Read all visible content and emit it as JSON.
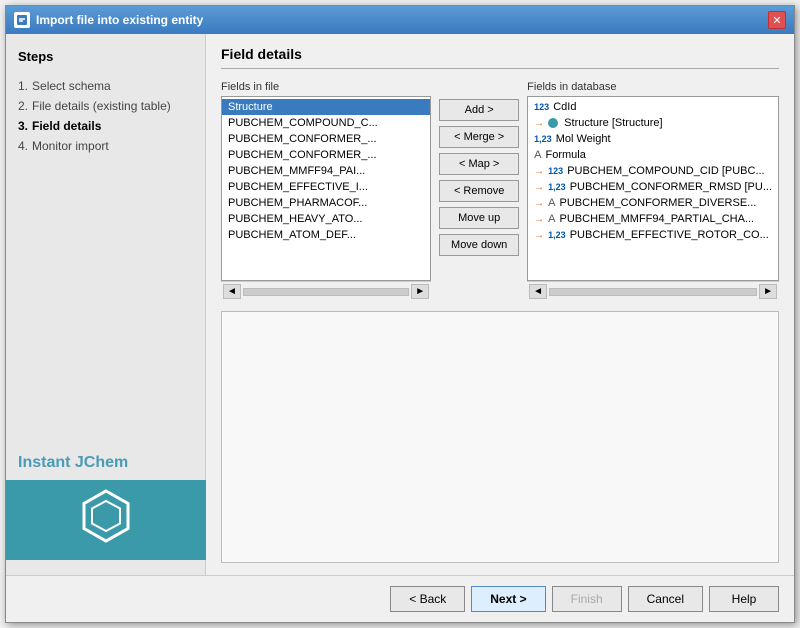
{
  "dialog": {
    "title": "Import file into existing entity",
    "close_label": "✕"
  },
  "sidebar": {
    "title": "Steps",
    "steps": [
      {
        "number": "1.",
        "label": "Select schema",
        "active": false
      },
      {
        "number": "2.",
        "label": "File details (existing table)",
        "active": false
      },
      {
        "number": "3.",
        "label": "Field details",
        "active": true
      },
      {
        "number": "4.",
        "label": "Monitor import",
        "active": false
      }
    ],
    "brand_text": "Instant JChem"
  },
  "main": {
    "section_title": "Field details",
    "fields_in_file_label": "Fields in file",
    "fields_in_database_label": "Fields in database",
    "file_fields": [
      {
        "name": "Structure",
        "header": true
      },
      {
        "name": "PUBCHEM_COMPOUND_C..."
      },
      {
        "name": "PUBCHEM_CONFORMER..."
      },
      {
        "name": "PUBCHEM_CONFORMER..."
      },
      {
        "name": "PUBCHEM_MMFF94_PAI..."
      },
      {
        "name": "PUBCHEM_EFFECTIVE_I..."
      },
      {
        "name": "PUBCHEM_PHARMACOF..."
      },
      {
        "name": "PUBCHEM_HEAVY_ATO..."
      },
      {
        "name": "PUBCHEM_ATOM_DEF..."
      }
    ],
    "db_fields": [
      {
        "name": "CdId",
        "type": "123",
        "arrow": false
      },
      {
        "name": "Structure [Structure]",
        "type": "circle",
        "arrow": false
      },
      {
        "name": "Mol Weight",
        "type": "123dot",
        "arrow": false
      },
      {
        "name": "Formula",
        "type": "A",
        "arrow": false
      },
      {
        "name": "PUBCHEM_COMPOUND_CID [PUBC...",
        "type": "123",
        "arrow": true
      },
      {
        "name": "PUBCHEM_CONFORMER_RMSD [PU...",
        "type": "123",
        "arrow": true
      },
      {
        "name": "PUBCHEM_CONFORMER_DIVERSE...",
        "type": "A",
        "arrow": true
      },
      {
        "name": "PUBCHEM_MMFF94_PARTIAL_CHA...",
        "type": "A",
        "arrow": true
      },
      {
        "name": "PUBCHEM_EFFECTIVE_ROTOR_CO...",
        "type": "123",
        "arrow": true
      }
    ],
    "buttons": {
      "add": "Add >",
      "merge": "< Merge >",
      "map": "< Map >",
      "remove": "< Remove",
      "move_up": "Move up",
      "move_down": "Move down"
    }
  },
  "footer": {
    "back_label": "< Back",
    "next_label": "Next >",
    "finish_label": "Finish",
    "cancel_label": "Cancel",
    "help_label": "Help"
  }
}
